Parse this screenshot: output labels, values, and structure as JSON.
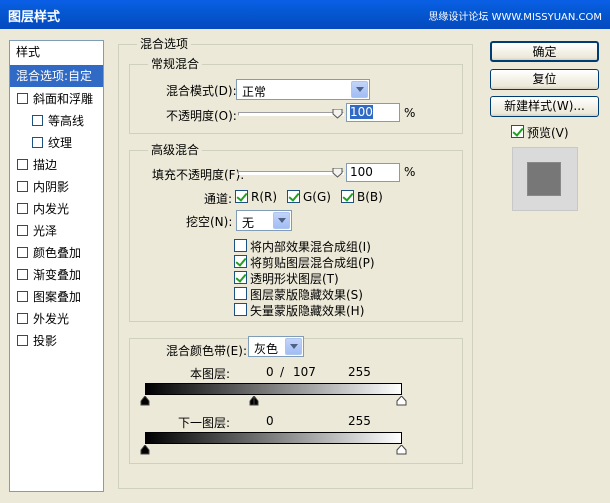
{
  "window": {
    "title": "图层样式",
    "watermark": "思缘设计论坛 WWW.MISSYUAN.COM"
  },
  "sidebar": {
    "header": "样式",
    "items": [
      {
        "label": "混合选项:自定",
        "checkbox": false,
        "selected": true
      },
      {
        "label": "斜面和浮雕",
        "checkbox": true,
        "checked": false
      },
      {
        "label": "等高线",
        "checkbox": true,
        "checked": false,
        "indent": true
      },
      {
        "label": "纹理",
        "checkbox": true,
        "checked": false,
        "indent": true
      },
      {
        "label": "描边",
        "checkbox": true,
        "checked": false
      },
      {
        "label": "内阴影",
        "checkbox": true,
        "checked": false
      },
      {
        "label": "内发光",
        "checkbox": true,
        "checked": false
      },
      {
        "label": "光泽",
        "checkbox": true,
        "checked": false
      },
      {
        "label": "颜色叠加",
        "checkbox": true,
        "checked": false
      },
      {
        "label": "渐变叠加",
        "checkbox": true,
        "checked": false
      },
      {
        "label": "图案叠加",
        "checkbox": true,
        "checked": false
      },
      {
        "label": "外发光",
        "checkbox": true,
        "checked": false
      },
      {
        "label": "投影",
        "checkbox": true,
        "checked": false
      }
    ]
  },
  "blend_options": {
    "title": "混合选项",
    "general": {
      "title": "常规混合",
      "mode_label": "混合模式(D):",
      "mode_value": "正常",
      "opacity_label": "不透明度(O):",
      "opacity_value": "100",
      "percent": "%"
    },
    "advanced": {
      "title": "高级混合",
      "fill_label": "填充不透明度(F):",
      "fill_value": "100",
      "percent": "%",
      "channels_label": "通道:",
      "channels": [
        {
          "label": "R(R)",
          "checked": true
        },
        {
          "label": "G(G)",
          "checked": true
        },
        {
          "label": "B(B)",
          "checked": true
        }
      ],
      "knockout_label": "挖空(N):",
      "knockout_value": "无",
      "options": [
        {
          "label": "将内部效果混合成组(I)",
          "checked": false
        },
        {
          "label": "将剪贴图层混合成组(P)",
          "checked": true
        },
        {
          "label": "透明形状图层(T)",
          "checked": true
        },
        {
          "label": "图层蒙版隐藏效果(S)",
          "checked": false
        },
        {
          "label": "矢量蒙版隐藏效果(H)",
          "checked": false
        }
      ]
    },
    "blend_if": {
      "label": "混合颜色带(E):",
      "value": "灰色",
      "this_layer": {
        "label": "本图层:",
        "min": "0",
        "slash": "/",
        "mid": "107",
        "max": "255"
      },
      "underlying": {
        "label": "下一图层:",
        "min": "0",
        "max": "255"
      }
    }
  },
  "buttons": {
    "ok": "确定",
    "reset": "复位",
    "new_style": "新建样式(W)...",
    "preview_label": "预览(V)",
    "preview_checked": true
  },
  "colors": {
    "title_bar": "#0558d2",
    "selection": "#316ac5",
    "check": "#21a121"
  }
}
